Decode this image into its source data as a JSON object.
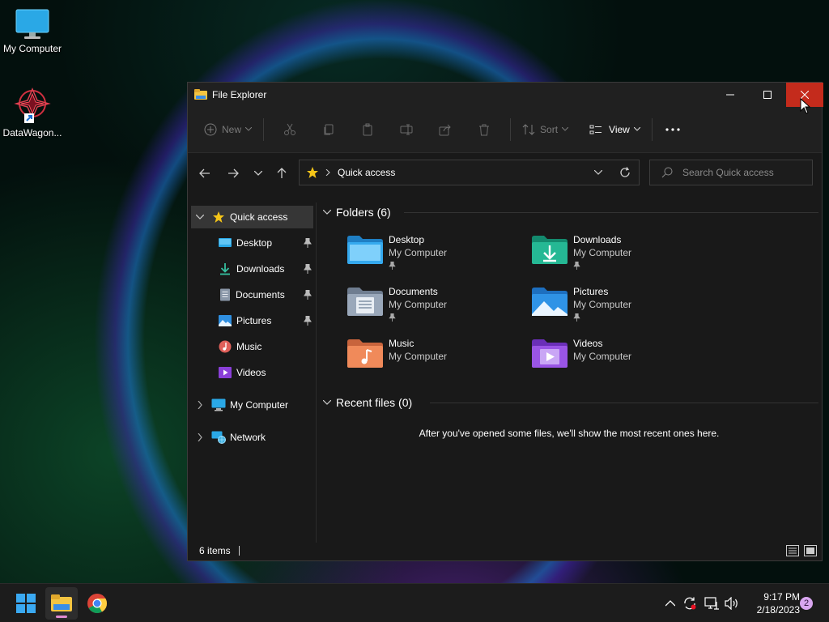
{
  "desktop": {
    "icons": [
      {
        "label": "My Computer",
        "icon": "monitor-icon"
      },
      {
        "label": "DataWagon...",
        "icon": "datawagon-app-icon"
      }
    ]
  },
  "window": {
    "title": "File Explorer",
    "toolbar": {
      "new_label": "New",
      "sort_label": "Sort",
      "view_label": "View"
    },
    "address": {
      "location": "Quick access"
    },
    "search": {
      "placeholder": "Search Quick access"
    },
    "sidebar": {
      "quick_access": "Quick access",
      "items": [
        {
          "label": "Desktop",
          "pinned": true,
          "icon": "desktop-folder-icon"
        },
        {
          "label": "Downloads",
          "pinned": true,
          "icon": "download-icon"
        },
        {
          "label": "Documents",
          "pinned": true,
          "icon": "document-icon"
        },
        {
          "label": "Pictures",
          "pinned": true,
          "icon": "pictures-icon"
        },
        {
          "label": "Music",
          "pinned": false,
          "icon": "music-icon"
        },
        {
          "label": "Videos",
          "pinned": false,
          "icon": "videos-icon"
        }
      ],
      "my_computer": "My Computer",
      "network": "Network"
    },
    "main": {
      "folders_header": "Folders (6)",
      "folders": [
        {
          "name": "Desktop",
          "location": "My Computer",
          "pinned": true
        },
        {
          "name": "Downloads",
          "location": "My Computer",
          "pinned": true
        },
        {
          "name": "Documents",
          "location": "My Computer",
          "pinned": true
        },
        {
          "name": "Pictures",
          "location": "My Computer",
          "pinned": true
        },
        {
          "name": "Music",
          "location": "My Computer",
          "pinned": false
        },
        {
          "name": "Videos",
          "location": "My Computer",
          "pinned": false
        }
      ],
      "recent_header": "Recent files (0)",
      "recent_empty_message": "After you've opened some files, we'll show the most recent ones here."
    },
    "status": {
      "item_count": "6 items"
    }
  },
  "taskbar": {
    "time": "9:17 PM",
    "date": "2/18/2023",
    "notification_count": "2"
  },
  "colors": {
    "close_button": "#c42b1c",
    "accent_blue": "#0078d4",
    "star": "#f5c518"
  }
}
